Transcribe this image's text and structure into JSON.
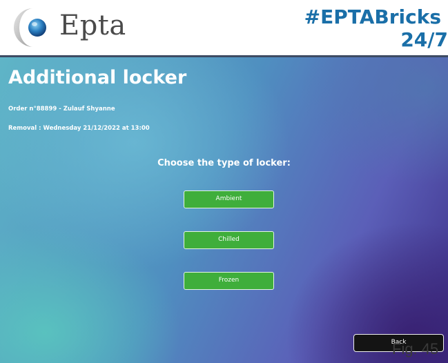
{
  "header": {
    "logo_text": "Epta",
    "logo_icon": "epta-sphere-icon",
    "hashtag_line1": "#EPTABricks",
    "hashtag_line2": "24/7"
  },
  "main": {
    "title": "Additional locker",
    "order": "Order n°88899 - Zulauf Shyanne",
    "removal": "Removal : Wednesday 21/12/2022 at 13:00",
    "prompt": "Choose the type of locker:",
    "options": [
      {
        "label": "Ambient"
      },
      {
        "label": "Chilled"
      },
      {
        "label": "Frozen"
      }
    ],
    "back_label": "Back"
  },
  "figure_label": "Fig. 45",
  "colors": {
    "option_button": "#3fae3b",
    "back_button": "#141414",
    "hashtag": "#1a6fa8",
    "header_rule": "#3d4b63"
  }
}
